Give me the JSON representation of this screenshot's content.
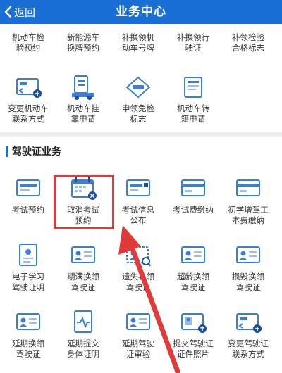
{
  "header": {
    "back_label": "返回",
    "title": "业务中心"
  },
  "colors": {
    "brand": "#1a6fd6",
    "highlight": "#e03a3a",
    "arrow": "#e03a3a"
  },
  "vehicle_rows": [
    {
      "items": [
        {
          "label": "机动车检\n验预约",
          "icon": "calendar-icon"
        },
        {
          "label": "新能源车\n换牌预约",
          "icon": "plate-icon"
        },
        {
          "label": "补换领机\n动车号牌",
          "icon": "plate-icon"
        },
        {
          "label": "补换领行\n驶证",
          "icon": "license-icon"
        },
        {
          "label": "补领检验\n合格标志",
          "icon": "badge-icon"
        }
      ]
    },
    {
      "items": [
        {
          "label": "变更机动车\n联系方式",
          "icon": "contact-card-icon"
        },
        {
          "label": "机动车挂\n靠申请",
          "icon": "truck-icon"
        },
        {
          "label": "申领免检\n标志",
          "icon": "exempt-sign-icon"
        },
        {
          "label": "机动车转\n籍申请",
          "icon": "document-icon"
        }
      ]
    }
  ],
  "section": {
    "title": "驾驶证业务"
  },
  "license_rows": [
    {
      "items": [
        {
          "label": "考试预约",
          "icon": "exam-card-icon"
        },
        {
          "label": "取消考试\n预约",
          "icon": "calendar-cancel-icon"
        },
        {
          "label": "考试信息\n公布",
          "icon": "exam-info-icon"
        },
        {
          "label": "考试费缴纳",
          "icon": "payment-card-icon"
        },
        {
          "label": "初学增驾工\n本费缴纳",
          "icon": "payment-card-icon"
        }
      ]
    },
    {
      "items": [
        {
          "label": "电子学习\n驾驶证明",
          "icon": "certificate-icon"
        },
        {
          "label": "期满换领\n驾驶证",
          "icon": "id-card-icon"
        },
        {
          "label": "遗失补领\n驾驶证",
          "icon": "id-card-search-icon"
        },
        {
          "label": "超龄换领\n驾驶证",
          "icon": "id-card-icon"
        },
        {
          "label": "损毁换领\n驾驶证",
          "icon": "id-card-icon"
        }
      ]
    },
    {
      "items": [
        {
          "label": "延期换领\n驾驶证",
          "icon": "id-card-icon"
        },
        {
          "label": "延期提交\n身体证明",
          "icon": "health-icon"
        },
        {
          "label": "延期驾驶\n证审验",
          "icon": "id-card-icon"
        },
        {
          "label": "提交驾驶证\n证件照片",
          "icon": "photo-card-icon"
        },
        {
          "label": "变更驾驶证\n联系方式",
          "icon": "contact-card-icon"
        }
      ]
    }
  ]
}
